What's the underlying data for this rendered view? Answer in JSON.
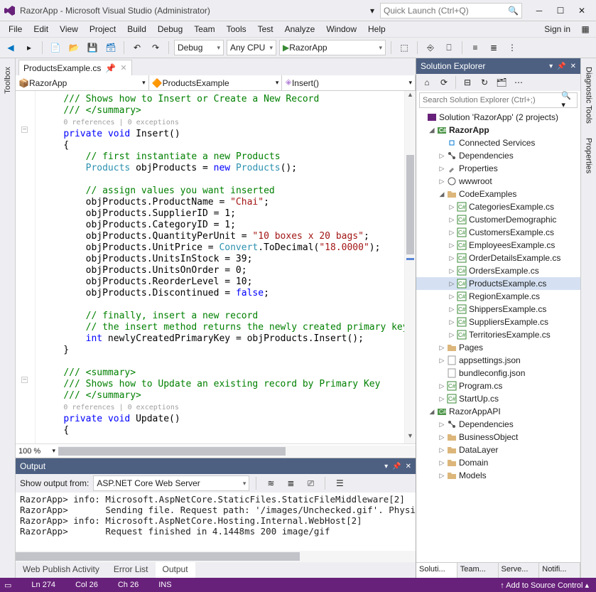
{
  "title": "RazorApp - Microsoft Visual Studio  (Administrator)",
  "quicklaunch_placeholder": "Quick Launch (Ctrl+Q)",
  "menubar": [
    "File",
    "Edit",
    "View",
    "Project",
    "Build",
    "Debug",
    "Team",
    "Tools",
    "Test",
    "Analyze",
    "Window",
    "Help"
  ],
  "signin": "Sign in",
  "toolbar": {
    "config": "Debug",
    "platform": "Any CPU",
    "startup": "RazorApp"
  },
  "leftrail": "Toolbox",
  "rightrail": [
    "Diagnostic Tools",
    "Properties"
  ],
  "file_tab": "ProductsExample.cs",
  "nav": {
    "project": "RazorApp",
    "class": "ProductsExample",
    "member": "Insert()"
  },
  "zoom": "100 %",
  "codelens": "0 references | 0 exceptions",
  "code_lines": [
    {
      "t": "cmt",
      "s": "/// Shows how to Insert or Create a New Record"
    },
    {
      "t": "cmt",
      "s": "/// </summary>"
    },
    {
      "t": "ref",
      "s": "0 references | 0 exceptions"
    },
    {
      "t": "sig",
      "s": "private void Insert()"
    },
    {
      "t": "plain",
      "s": "{"
    },
    {
      "t": "cmt2",
      "s": "    // first instantiate a new Products"
    },
    {
      "t": "inst",
      "s": "    Products objProducts = new Products();"
    },
    {
      "t": "blank",
      "s": ""
    },
    {
      "t": "cmt2",
      "s": "    // assign values you want inserted"
    },
    {
      "t": "assignstr",
      "s": "    objProducts.ProductName = \"Chai\";"
    },
    {
      "t": "plain",
      "s": "    objProducts.SupplierID = 1;"
    },
    {
      "t": "plain",
      "s": "    objProducts.CategoryID = 1;"
    },
    {
      "t": "assignstr",
      "s": "    objProducts.QuantityPerUnit = \"10 boxes x 20 bags\";"
    },
    {
      "t": "conv",
      "s": "    objProducts.UnitPrice = Convert.ToDecimal(\"18.0000\");"
    },
    {
      "t": "plain",
      "s": "    objProducts.UnitsInStock = 39;"
    },
    {
      "t": "plain",
      "s": "    objProducts.UnitsOnOrder = 0;"
    },
    {
      "t": "plain",
      "s": "    objProducts.ReorderLevel = 10;"
    },
    {
      "t": "discfalse",
      "s": "    objProducts.Discontinued = false;"
    },
    {
      "t": "blank",
      "s": ""
    },
    {
      "t": "cmt2",
      "s": "    // finally, insert a new record"
    },
    {
      "t": "cmt2",
      "s": "    // the insert method returns the newly created primary key"
    },
    {
      "t": "intline",
      "s": "    int newlyCreatedPrimaryKey = objProducts.Insert();"
    },
    {
      "t": "plain",
      "s": "}"
    },
    {
      "t": "blank",
      "s": ""
    },
    {
      "t": "cmt",
      "s": "/// <summary>"
    },
    {
      "t": "cmt",
      "s": "/// Shows how to Update an existing record by Primary Key"
    },
    {
      "t": "cmt",
      "s": "/// </summary>"
    },
    {
      "t": "ref",
      "s": "0 references | 0 exceptions"
    },
    {
      "t": "sig",
      "s": "private void Update()"
    },
    {
      "t": "plain",
      "s": "{"
    }
  ],
  "output": {
    "title": "Output",
    "show_from_label": "Show output from:",
    "source": "ASP.NET Core Web Server",
    "lines": [
      "RazorApp> info: Microsoft.AspNetCore.StaticFiles.StaticFileMiddleware[2]",
      "RazorApp>       Sending file. Request path: '/images/Unchecked.gif'. Physic",
      "RazorApp> info: Microsoft.AspNetCore.Hosting.Internal.WebHost[2]",
      "RazorApp>       Request finished in 4.1448ms 200 image/gif"
    ]
  },
  "bottom_tabs": [
    "Web Publish Activity",
    "Error List",
    "Output"
  ],
  "solution_explorer": {
    "title": "Solution Explorer",
    "search_placeholder": "Search Solution Explorer (Ctrl+;)",
    "root": "Solution 'RazorApp' (2 projects)",
    "proj1": "RazorApp",
    "items1": [
      "Connected Services",
      "Dependencies",
      "Properties",
      "wwwroot"
    ],
    "code_examples": "CodeExamples",
    "examples": [
      "CategoriesExample.cs",
      "CustomerDemographic",
      "CustomersExample.cs",
      "EmployeesExample.cs",
      "OrderDetailsExample.cs",
      "OrdersExample.cs",
      "ProductsExample.cs",
      "RegionExample.cs",
      "ShippersExample.cs",
      "SuppliersExample.cs",
      "TerritoriesExample.cs"
    ],
    "items2": [
      "Pages",
      "appsettings.json",
      "bundleconfig.json",
      "Program.cs",
      "StartUp.cs"
    ],
    "proj2": "RazorAppAPI",
    "items3": [
      "Dependencies",
      "BusinessObject",
      "DataLayer",
      "Domain",
      "Models"
    ]
  },
  "right_tabs": [
    "Soluti...",
    "Team...",
    "Serve...",
    "Notifi..."
  ],
  "status": {
    "ready": "",
    "ln": "Ln 274",
    "col": "Col 26",
    "ch": "Ch 26",
    "mode": "INS",
    "src": "↑ Add to Source Control ▴"
  }
}
